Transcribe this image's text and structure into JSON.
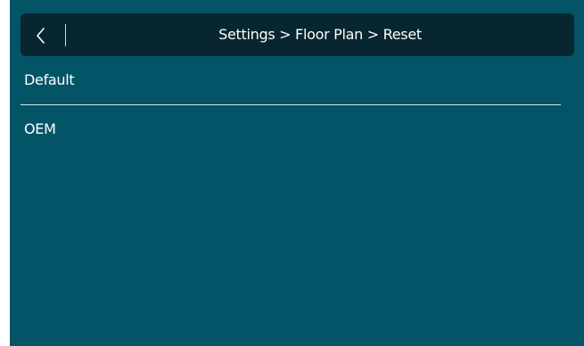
{
  "header": {
    "breadcrumb": "Settings > Floor Plan > Reset",
    "back_icon": "chevron-left-icon"
  },
  "options": [
    {
      "label": "Default"
    },
    {
      "label": "OEM"
    }
  ],
  "colors": {
    "background": "#045468",
    "header_bg": "#07262f",
    "text": "#ffffff"
  }
}
